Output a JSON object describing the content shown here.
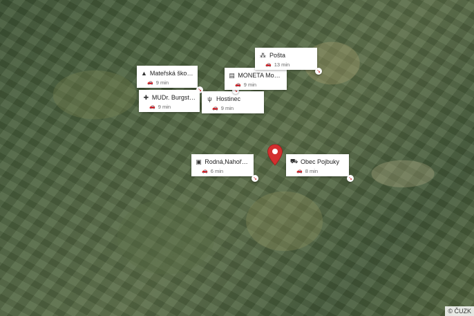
{
  "map": {
    "copyright": "© ČUZK",
    "marker": {
      "icon": "location-pin-icon",
      "color": "#d32f2f"
    }
  },
  "pois": [
    {
      "id": "skolka",
      "icon": "school-icon",
      "glyph": "▲",
      "name": "Mateřská škola M...",
      "time": "9 min"
    },
    {
      "id": "lekar",
      "icon": "medical-icon",
      "glyph": "✚",
      "name": "MUDr. Burgstaller...",
      "time": "9 min"
    },
    {
      "id": "hostinec",
      "icon": "restaurant-icon",
      "glyph": "ψ",
      "name": "Hostinec",
      "time": "9 min"
    },
    {
      "id": "moneta",
      "icon": "bank-icon",
      "glyph": "▤",
      "name": "MONETA Money ...",
      "time": "9 min"
    },
    {
      "id": "posta",
      "icon": "post-office-icon",
      "glyph": "⁂",
      "name": "Pošta",
      "time": "13 min"
    },
    {
      "id": "bus",
      "icon": "bus-icon",
      "glyph": "▣",
      "name": "Rodná,Nahořany,...",
      "time": "6 min"
    },
    {
      "id": "obec",
      "icon": "shopping-cart-icon",
      "glyph": "⛟",
      "name": "Obec Pojbuky",
      "time": "8 min"
    }
  ],
  "travel_icon": "🚗",
  "direction_glyph": "↘"
}
